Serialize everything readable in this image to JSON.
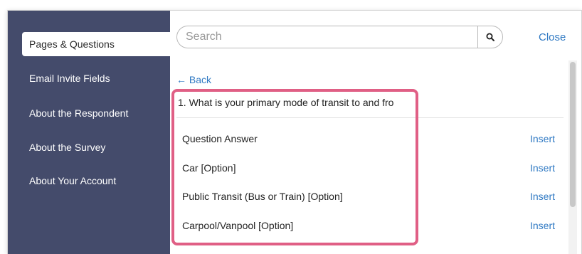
{
  "sidebar": {
    "items": [
      {
        "label": "Pages & Questions",
        "active": true
      },
      {
        "label": "Email Invite Fields",
        "active": false
      },
      {
        "label": "About the Respondent",
        "active": false
      },
      {
        "label": "About the Survey",
        "active": false
      },
      {
        "label": "About Your Account",
        "active": false
      }
    ]
  },
  "search": {
    "placeholder": "Search",
    "value": "",
    "icon": "search-icon"
  },
  "close_label": "Close",
  "back_label": "← Back",
  "question_title": "1. What is your primary mode of transit to and fro",
  "rows": [
    {
      "label": "Question Answer",
      "action": "Insert"
    },
    {
      "label": "Car [Option]",
      "action": "Insert"
    },
    {
      "label": "Public Transit (Bus or Train) [Option]",
      "action": "Insert"
    },
    {
      "label": "Carpool/Vanpool [Option]",
      "action": "Insert"
    }
  ],
  "colors": {
    "sidebar_bg": "#444b6b",
    "link": "#2f79c3",
    "highlight": "#e05f85"
  }
}
